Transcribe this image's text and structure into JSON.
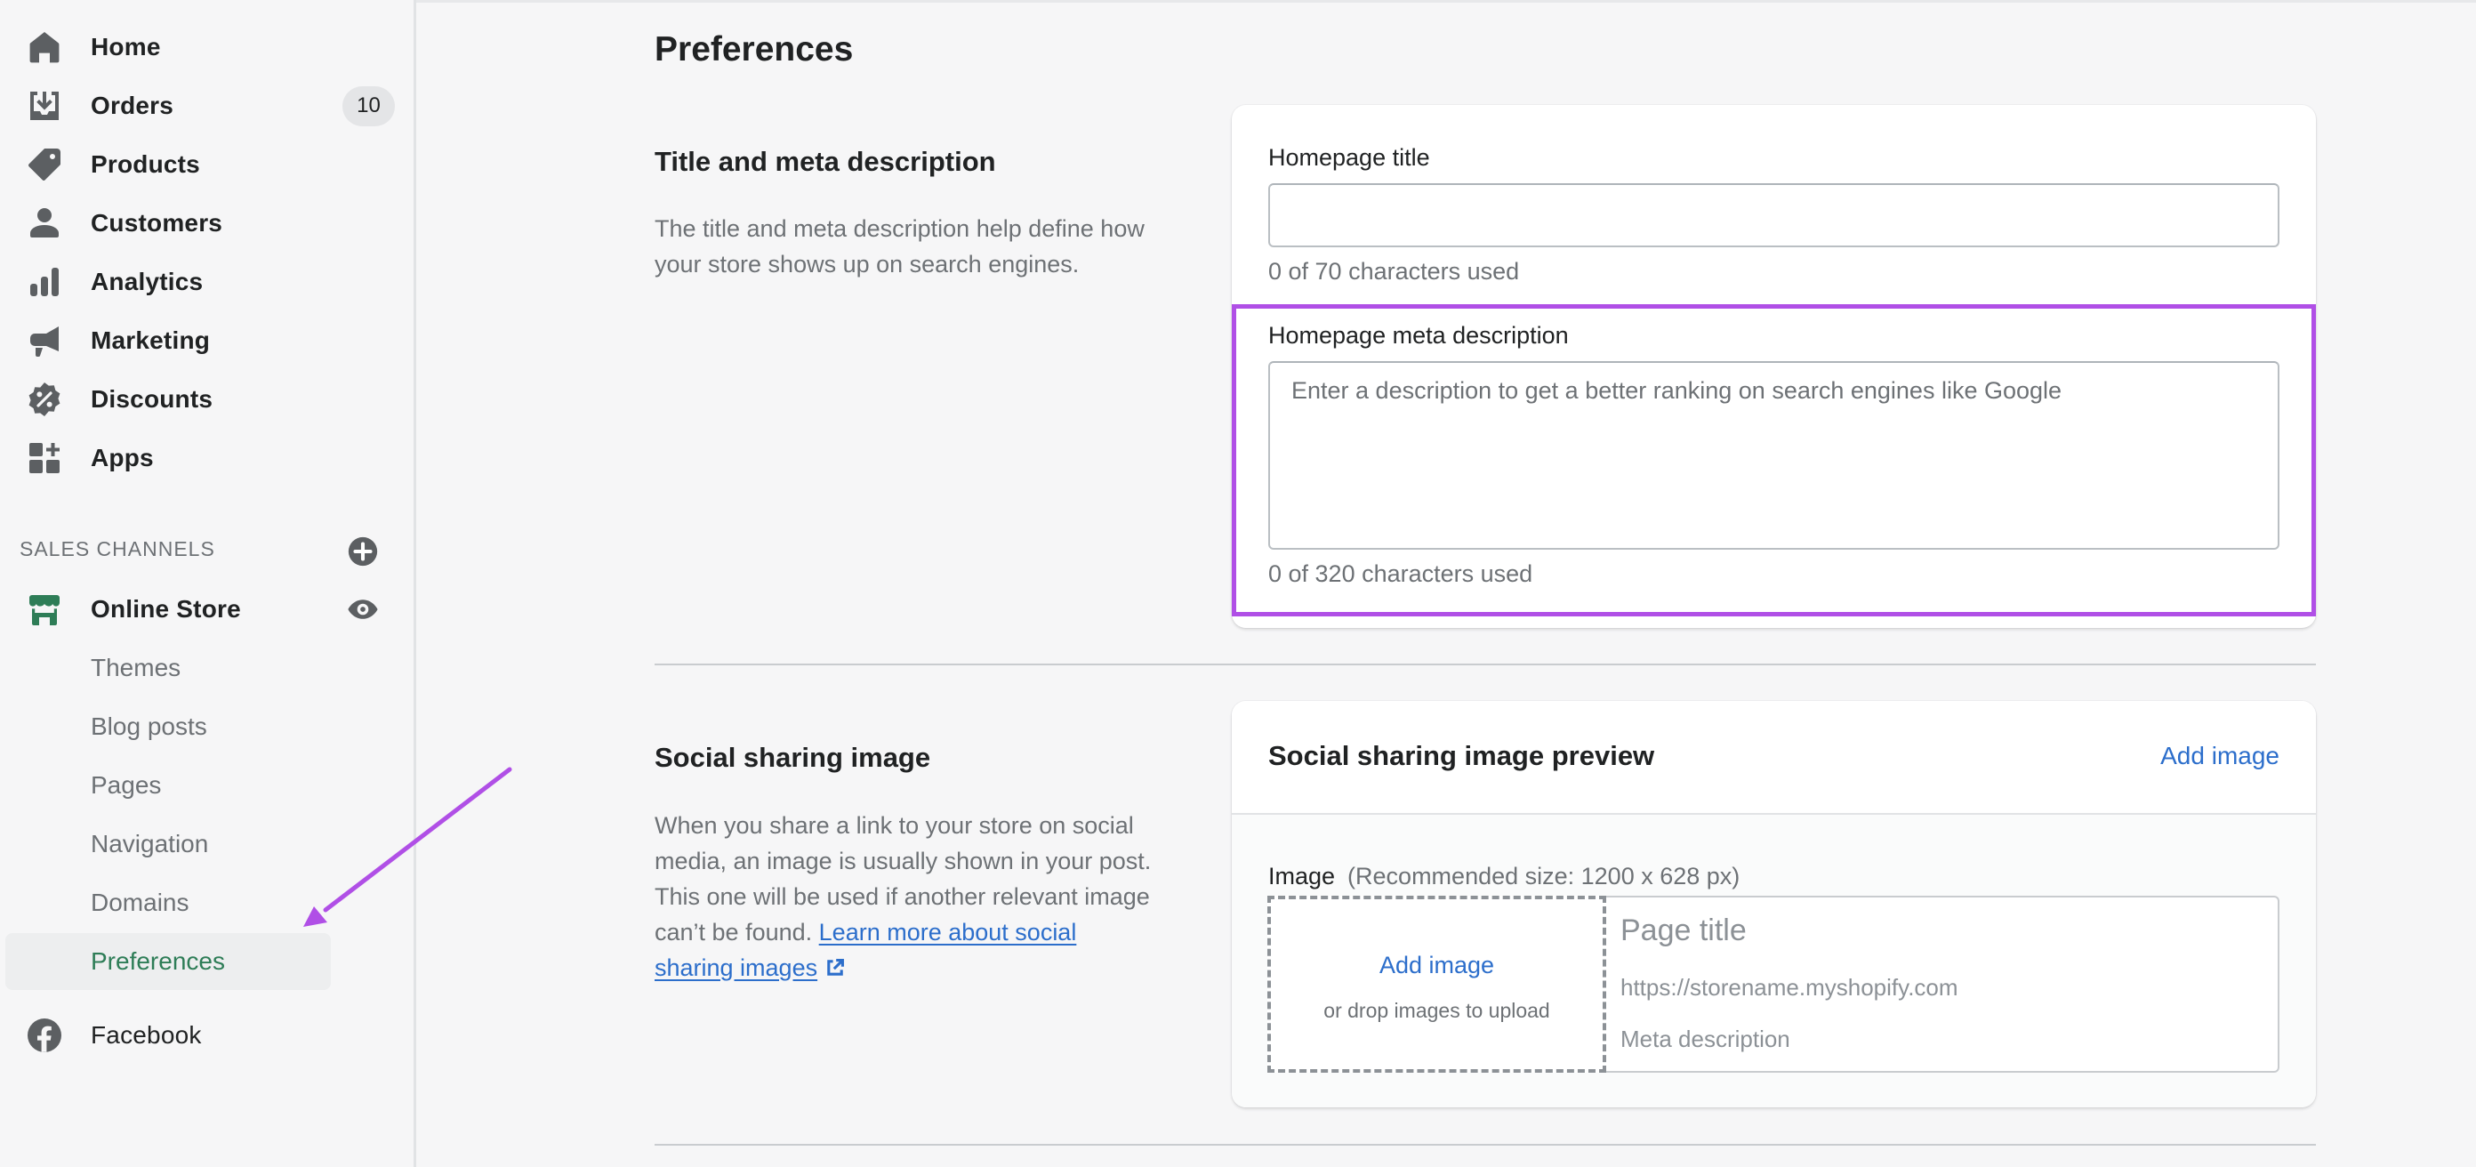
{
  "sidebar": {
    "items": [
      {
        "label": "Home",
        "icon": "home-icon"
      },
      {
        "label": "Orders",
        "icon": "orders-icon",
        "badge": "10"
      },
      {
        "label": "Products",
        "icon": "tag-icon"
      },
      {
        "label": "Customers",
        "icon": "person-icon"
      },
      {
        "label": "Analytics",
        "icon": "bar-chart-icon"
      },
      {
        "label": "Marketing",
        "icon": "megaphone-icon"
      },
      {
        "label": "Discounts",
        "icon": "discount-badge-icon"
      },
      {
        "label": "Apps",
        "icon": "apps-icon"
      }
    ],
    "sales_channels_label": "SALES CHANNELS",
    "online_store": {
      "label": "Online Store",
      "icon": "store-icon",
      "action_icon": "eye-icon"
    },
    "sub_items": [
      {
        "label": "Themes"
      },
      {
        "label": "Blog posts"
      },
      {
        "label": "Pages"
      },
      {
        "label": "Navigation"
      },
      {
        "label": "Domains"
      },
      {
        "label": "Preferences",
        "active": true
      }
    ],
    "facebook": {
      "label": "Facebook",
      "icon": "facebook-icon"
    }
  },
  "main": {
    "page_title": "Preferences",
    "title_meta": {
      "heading": "Title and meta description",
      "description": "The title and meta description help define how your store shows up on search engines.",
      "homepage_title": {
        "label": "Homepage title",
        "value": "",
        "help": "0 of 70 characters used"
      },
      "meta_description": {
        "label": "Homepage meta description",
        "value": "",
        "placeholder": "Enter a description to get a better ranking on search engines like Google",
        "help": "0 of 320 characters used"
      }
    },
    "social": {
      "heading": "Social sharing image",
      "description": "When you share a link to your store on social media, an image is usually shown in your post. This one will be used if another relevant image can’t be found.",
      "link_text": "Learn more about social sharing images",
      "card_title": "Social sharing image preview",
      "card_action": "Add image",
      "image_label": "Image",
      "image_hint": "(Recommended size: 1200 x 628 px)",
      "dropzone_link": "Add image",
      "dropzone_hint": "or drop images to upload",
      "preview_title": "Page title",
      "preview_url": "https://storename.myshopify.com",
      "preview_description": "Meta description"
    }
  },
  "colors": {
    "accent_green": "#2e7d57",
    "link_blue": "#2c6ecb",
    "annotation_purple": "#b04fe6",
    "icon_gray": "#5c5f62"
  }
}
